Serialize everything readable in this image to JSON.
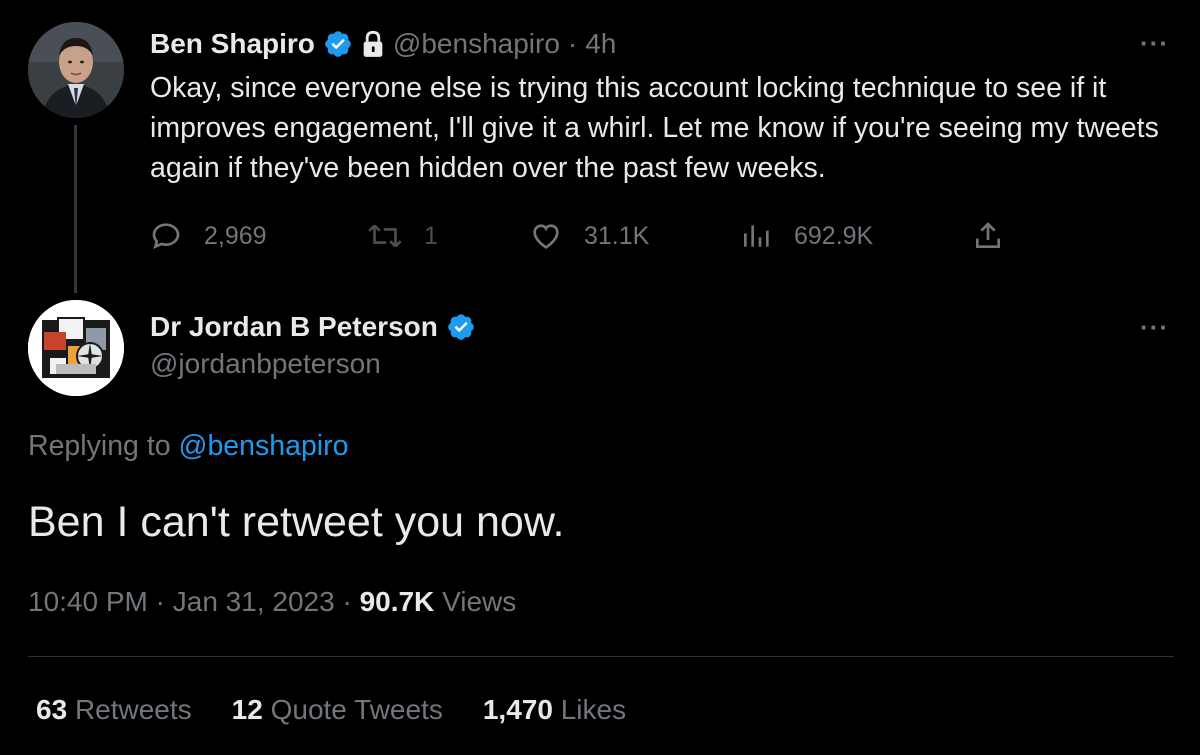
{
  "parent_tweet": {
    "author_name": "Ben Shapiro",
    "handle": "@benshapiro",
    "separator": "·",
    "time_ago": "4h",
    "more": "···",
    "text": "Okay, since everyone else is trying this account locking technique to see if it improves engagement, I'll give it a whirl. Let me know if you're seeing my tweets again if they've been hidden over the past few weeks.",
    "replies": "2,969",
    "retweets": "1",
    "likes": "31.1K",
    "views": "692.9K",
    "icons": [
      "verified-badge-icon",
      "lock-icon",
      "more-icon",
      "reply-icon",
      "retweet-icon",
      "like-icon",
      "views-icon",
      "share-icon"
    ]
  },
  "main_tweet": {
    "author_name": "Dr Jordan B Peterson",
    "handle": "@jordanbpeterson",
    "more": "···",
    "replying_prefix": "Replying to",
    "replying_handle": "@benshapiro",
    "text": "Ben I can't retweet you now.",
    "time": "10:40 PM",
    "sep1": "·",
    "date": "Jan 31, 2023",
    "sep2": "·",
    "views_count": "90.7K",
    "views_label": "Views",
    "stats": [
      {
        "num": "63",
        "label": "Retweets"
      },
      {
        "num": "12",
        "label": "Quote Tweets"
      },
      {
        "num": "1,470",
        "label": "Likes"
      }
    ]
  },
  "colors": {
    "background": "#000000",
    "text_primary": "#e7e9ea",
    "text_secondary": "#71767b",
    "link": "#1d9bf0",
    "verified": "#1d9bf0"
  }
}
